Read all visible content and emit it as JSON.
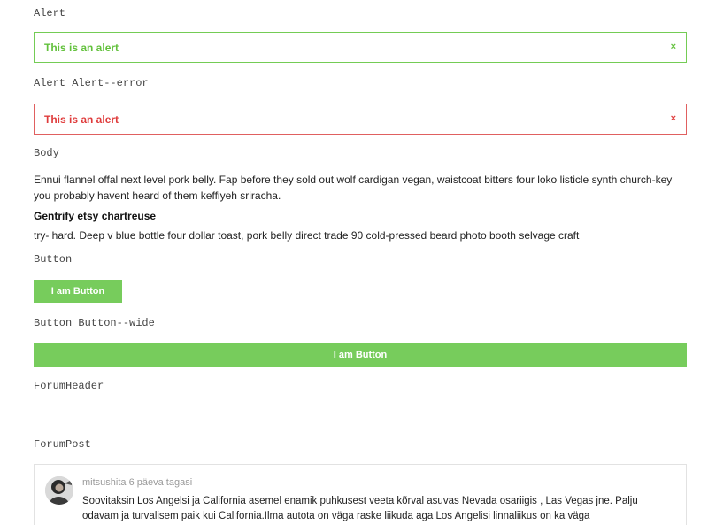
{
  "sections": {
    "alert": {
      "label": "Alert",
      "message": "This is an alert",
      "close_glyph": "×"
    },
    "alert_error": {
      "label": "Alert Alert--error",
      "message": "This is an alert",
      "close_glyph": "×"
    },
    "body": {
      "label": "Body",
      "paragraph1": "Ennui flannel offal next level pork belly. Fap before they sold out wolf cardigan vegan, waistcoat bitters four loko listicle synth church-key you probably havent heard of them keffiyeh sriracha.",
      "heading": "Gentrify etsy chartreuse",
      "paragraph2": "try- hard. Deep v blue bottle four dollar toast, pork belly direct trade 90 cold-pressed beard photo booth selvage craft"
    },
    "button": {
      "label": "Button",
      "text": "I am Button"
    },
    "button_wide": {
      "label": "Button Button--wide",
      "text": "I am Button"
    },
    "forum_header": {
      "label": "ForumHeader"
    },
    "forum_post": {
      "label": "ForumPost",
      "username": "mitsushita",
      "time": "6 päeva tagasi",
      "text": "Soovitaksin Los Angelsi ja California asemel enamik puhkusest veeta kõrval asuvas Nevada osariigis , Las Vegas jne. Palju odavam ja turvalisem paik kui California.Ilma autota on väga raske liikuda aga Los Angelisi linnaliikus on ka väga"
    }
  },
  "colors": {
    "success": "#62c13c",
    "success_border": "#74cc55",
    "error": "#df3b3b",
    "error_border": "#e06060",
    "button_bg": "#77cc5c"
  },
  "icons": {
    "close": "close-icon"
  }
}
